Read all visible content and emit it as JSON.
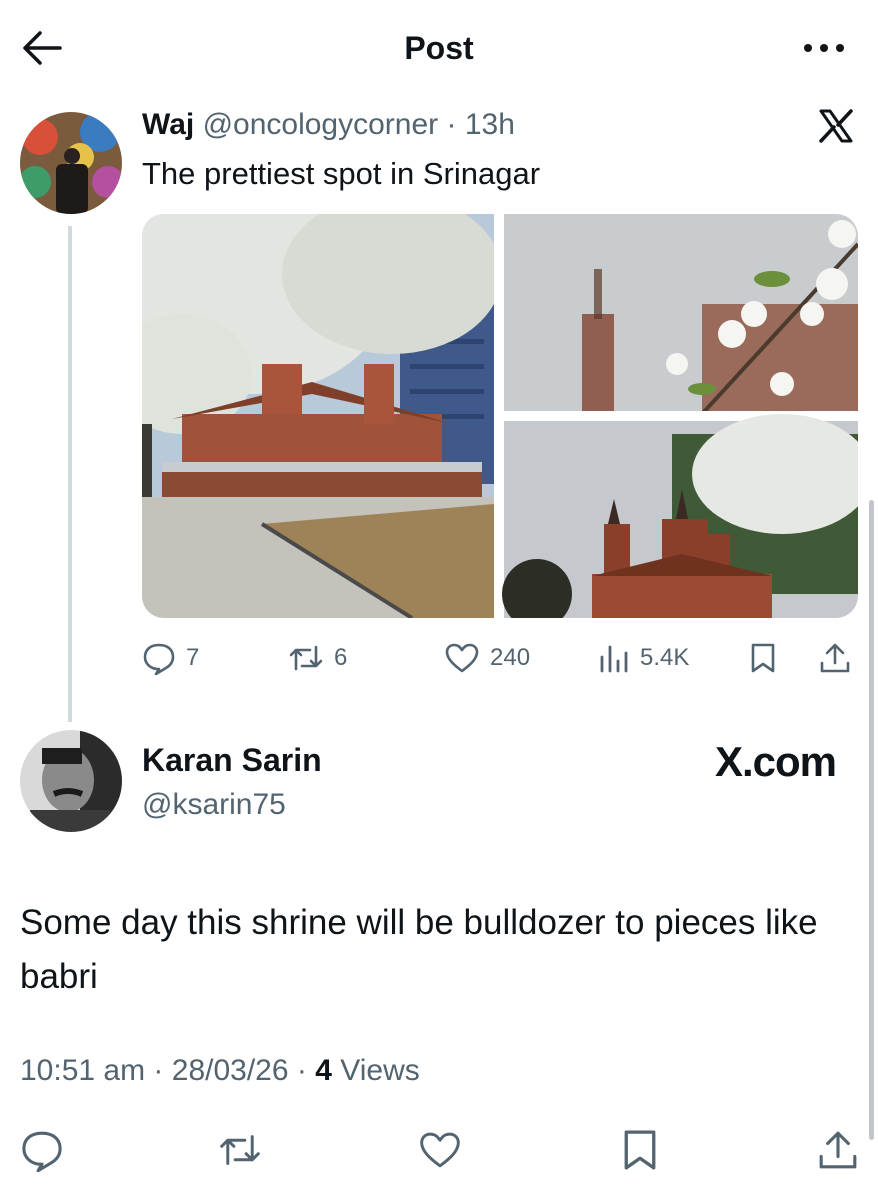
{
  "header": {
    "title": "Post"
  },
  "quoted_tweet": {
    "name": "Waj",
    "handle": "@oncologycorner",
    "separator": " · ",
    "time": "13h",
    "text": "The prettiest spot in Srinagar",
    "stats": {
      "replies": "7",
      "reposts": "6",
      "likes": "240",
      "views": "5.4K"
    }
  },
  "tweet": {
    "author_name": "Karan Sarin",
    "author_handle": "@ksarin75",
    "brand": "X.com",
    "text": "Some day this shrine will be bulldozer to pieces like babri",
    "time": "10:51 am",
    "date": "28/03/26",
    "separator": " · ",
    "views_count": "4",
    "views_label": "Views"
  },
  "colors": {
    "text": "#0f1419",
    "secondary": "#536471",
    "divider": "#cfd9de",
    "brick": "#9b4a33"
  }
}
